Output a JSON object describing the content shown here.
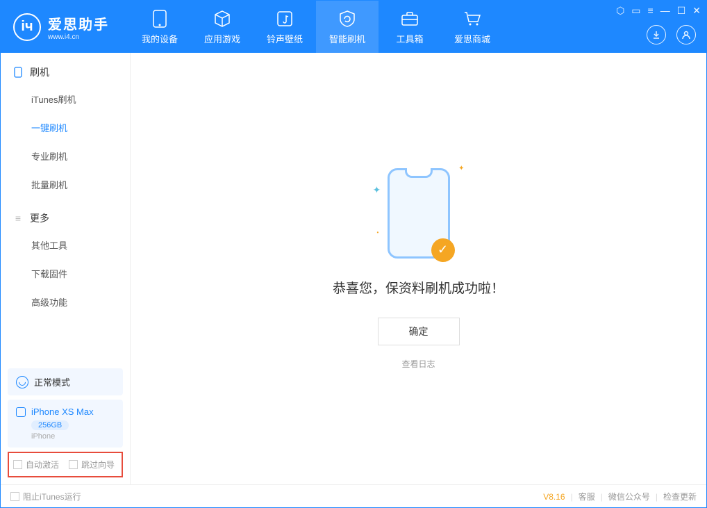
{
  "header": {
    "logo_title": "爱思助手",
    "logo_sub": "www.i4.cn",
    "nav": [
      {
        "label": "我的设备"
      },
      {
        "label": "应用游戏"
      },
      {
        "label": "铃声壁纸"
      },
      {
        "label": "智能刷机"
      },
      {
        "label": "工具箱"
      },
      {
        "label": "爱思商城"
      }
    ]
  },
  "sidebar": {
    "group1_title": "刷机",
    "group1_items": [
      "iTunes刷机",
      "一键刷机",
      "专业刷机",
      "批量刷机"
    ],
    "group2_title": "更多",
    "group2_items": [
      "其他工具",
      "下载固件",
      "高级功能"
    ],
    "mode_label": "正常模式",
    "device_name": "iPhone XS Max",
    "device_capacity": "256GB",
    "device_type": "iPhone",
    "check1": "自动激活",
    "check2": "跳过向导"
  },
  "main": {
    "success_text": "恭喜您，保资料刷机成功啦！",
    "ok_label": "确定",
    "log_link": "查看日志"
  },
  "footer": {
    "block_itunes": "阻止iTunes运行",
    "version": "V8.16",
    "links": [
      "客服",
      "微信公众号",
      "检查更新"
    ]
  }
}
